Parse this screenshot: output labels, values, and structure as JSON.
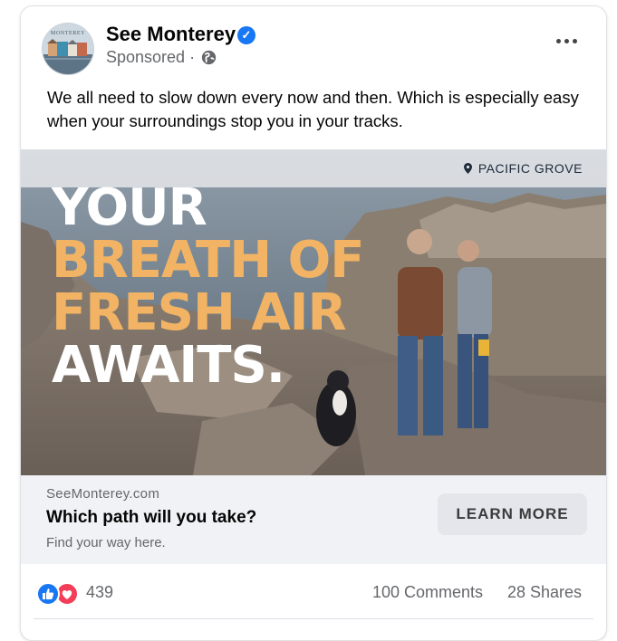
{
  "post": {
    "page_name": "See Monterey",
    "avatar_label": "MONTEREY",
    "sponsored_label": "Sponsored",
    "separator": "·",
    "caption": "We all need to slow down every now and then. Which is especially easy when your surroundings stop you in your tracks."
  },
  "creative": {
    "location": "PACIFIC GROVE",
    "headline": [
      "YOUR",
      "BREATH OF",
      "FRESH AIR",
      "AWAITS."
    ],
    "colors": {
      "white": "#ffffff",
      "accent": "#f2b464"
    }
  },
  "link_preview": {
    "domain": "SeeMonterey.com",
    "title": "Which path will you take?",
    "description": "Find your way here.",
    "cta_label": "LEARN MORE"
  },
  "engagement": {
    "reactions_count": "439",
    "comments": "100 Comments",
    "shares": "28 Shares"
  },
  "icons": [
    "verified-badge-icon",
    "globe-icon",
    "more-options-icon",
    "location-pin-icon",
    "like-reaction-icon",
    "love-reaction-icon"
  ],
  "brand_colors": {
    "facebook_blue": "#1877f2",
    "love_red": "#f33e58"
  }
}
